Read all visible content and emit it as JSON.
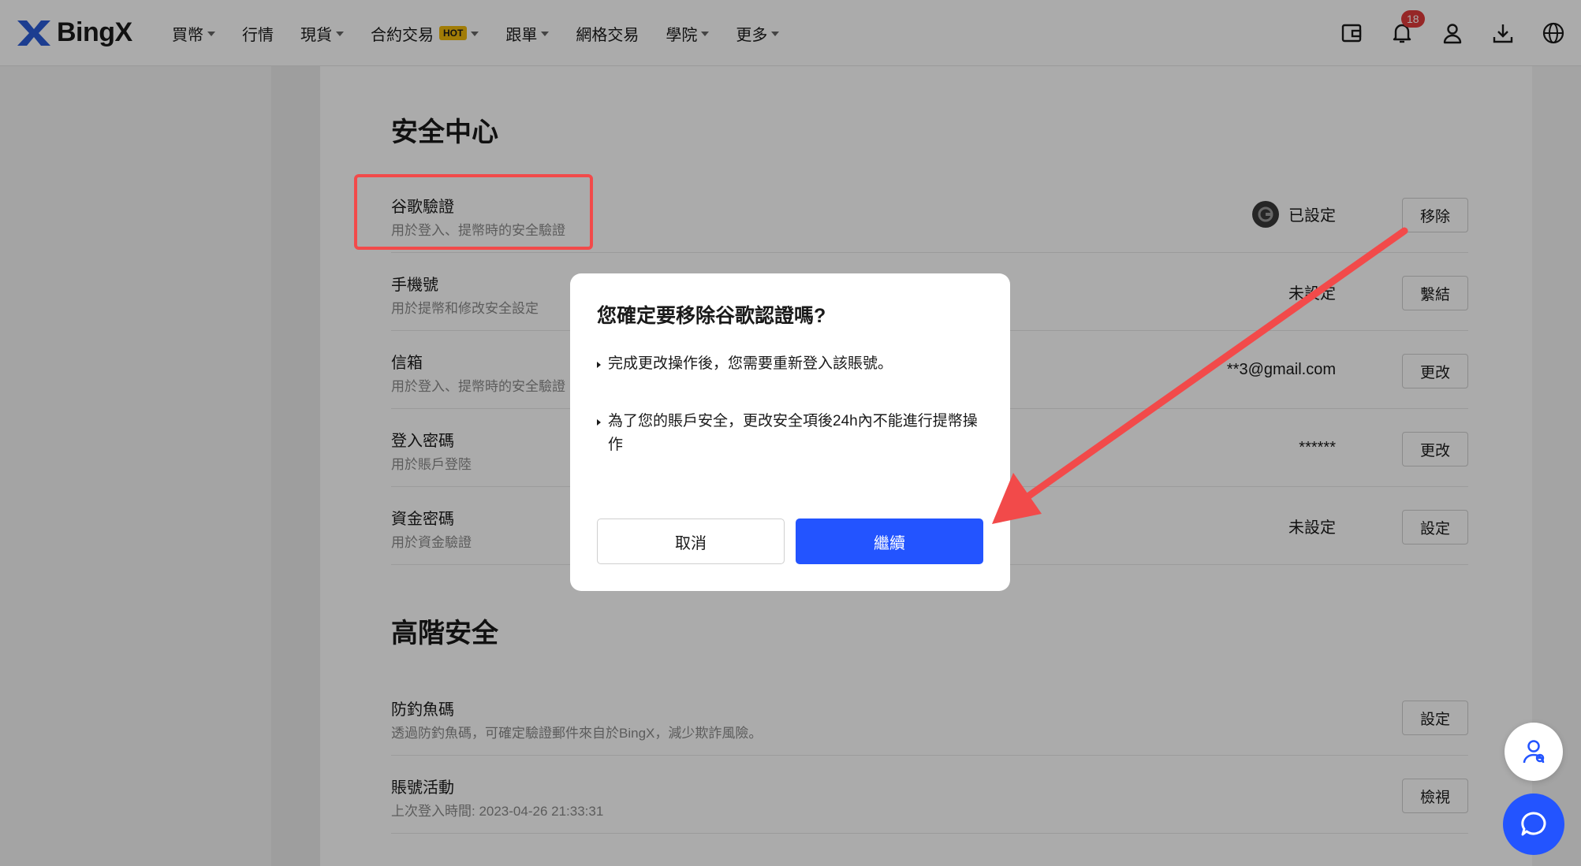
{
  "header": {
    "logo_text": "BingX",
    "nav": [
      {
        "label": "買幣",
        "dropdown": true,
        "hot": false
      },
      {
        "label": "行情",
        "dropdown": false,
        "hot": false
      },
      {
        "label": "現貨",
        "dropdown": true,
        "hot": false
      },
      {
        "label": "合約交易",
        "dropdown": true,
        "hot": true
      },
      {
        "label": "跟單",
        "dropdown": true,
        "hot": false
      },
      {
        "label": "網格交易",
        "dropdown": false,
        "hot": false
      },
      {
        "label": "學院",
        "dropdown": true,
        "hot": false
      },
      {
        "label": "更多",
        "dropdown": true,
        "hot": false
      }
    ],
    "hot_label": "HOT",
    "notification_count": "18",
    "icons": [
      "wallet-icon",
      "bell-icon",
      "user-icon",
      "download-icon",
      "globe-icon"
    ]
  },
  "security_center": {
    "title": "安全中心",
    "rows": [
      {
        "title": "谷歌驗證",
        "desc": "用於登入、提幣時的安全驗證",
        "status": "已設定",
        "button": "移除"
      },
      {
        "title": "手機號",
        "desc": "用於提幣和修改安全設定",
        "status": "未設定",
        "button": "繫結"
      },
      {
        "title": "信箱",
        "desc": "用於登入、提幣時的安全驗證",
        "status": "**3@gmail.com",
        "button": "更改"
      },
      {
        "title": "登入密碼",
        "desc": "用於賬戶登陸",
        "status": "******",
        "button": "更改"
      },
      {
        "title": "資金密碼",
        "desc": "用於資金驗證",
        "status": "未設定",
        "button": "設定"
      }
    ]
  },
  "advanced_security": {
    "title": "高階安全",
    "rows": [
      {
        "title": "防釣魚碼",
        "desc": "透過防釣魚碼，可確定驗證郵件來自於BingX，減少欺詐風險。",
        "button": "設定"
      },
      {
        "title": "賬號活動",
        "desc": "上次登入時間: 2023-04-26 21:33:31",
        "button": "檢視"
      }
    ]
  },
  "modal": {
    "title": "您確定要移除谷歌認證嗎?",
    "bullets": [
      "完成更改操作後，您需要重新登入該賬號。",
      "為了您的賬戶安全，更改安全項後24h內不能進行提幣操作"
    ],
    "cancel_label": "取消",
    "continue_label": "繼續"
  },
  "colors": {
    "brand_blue": "#2354ff",
    "annotation_red": "#f24a4a",
    "hot_badge": "#f0b90b"
  }
}
